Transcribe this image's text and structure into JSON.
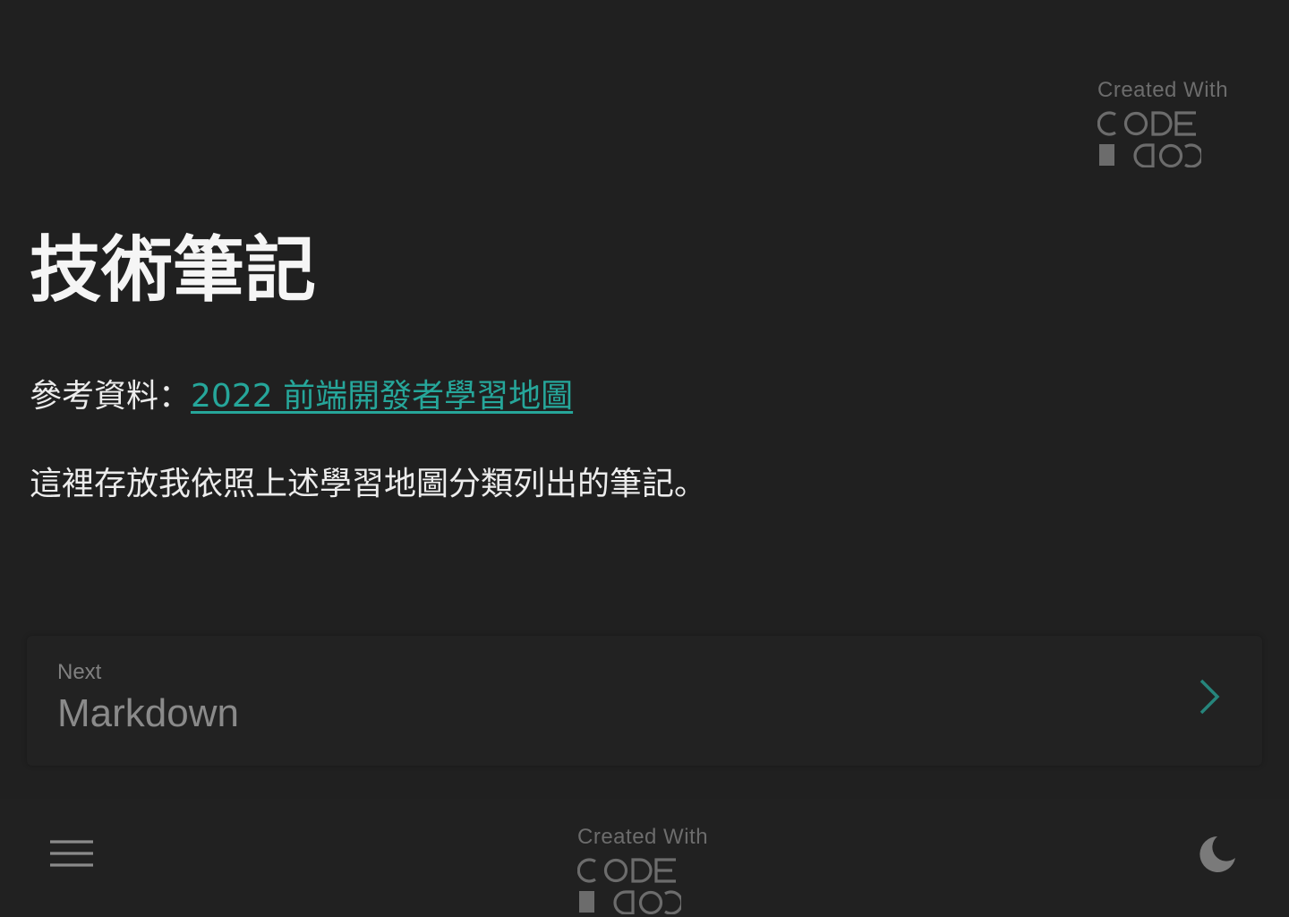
{
  "page": {
    "title": "技術筆記"
  },
  "content": {
    "reference_label": "參考資料：",
    "reference_link_text": "2022 前端開發者學習地圖",
    "description": "這裡存放我依照上述學習地圖分類列出的筆記。"
  },
  "branding": {
    "caption": "Created With",
    "logo_alt": "CODE COD"
  },
  "navigation": {
    "next_label": "Next",
    "next_title": "Markdown"
  },
  "colors": {
    "background": "#202020",
    "accent": "#26a69a",
    "muted": "#6c6c6c"
  },
  "icons": {
    "menu": "hamburger-menu-icon",
    "theme_toggle": "moon-icon",
    "next": "chevron-right-icon"
  }
}
